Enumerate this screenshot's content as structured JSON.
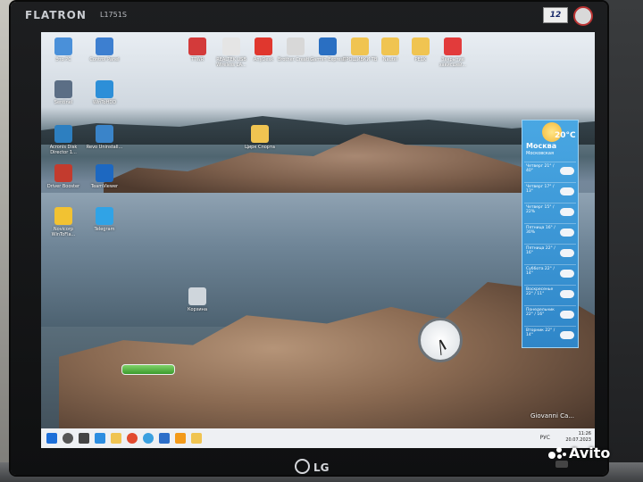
{
  "monitor": {
    "brand": "FLATRON",
    "model": "L1751S",
    "sticker_number": "12",
    "bottom_logo": "LG"
  },
  "desktop_icons": [
    {
      "label": "Это PC",
      "color": "#4a90d9"
    },
    {
      "label": "Control Panel",
      "color": "#3d7fd0"
    },
    {
      "label": "Sentinel",
      "color": "#5b6e85"
    },
    {
      "label": "WinToHDD",
      "color": "#2d8fd8"
    },
    {
      "label": "Acronis Disk Director 1...",
      "color": "#2d7fc0"
    },
    {
      "label": "Revo Uninstall...",
      "color": "#3a84c9"
    },
    {
      "label": "Driver Booster",
      "color": "#c33b2e"
    },
    {
      "label": "TeamViewer",
      "color": "#1d68c1"
    },
    {
      "label": "Novicorp WinToFla...",
      "color": "#f2c232"
    },
    {
      "label": "Telegram",
      "color": "#30a3e6"
    },
    {
      "label": "TTWR",
      "color": "#d33a3a"
    },
    {
      "label": "REALTEK USB Wireless LA...",
      "color": "#e5e5e5"
    },
    {
      "label": "AnyDesk",
      "color": "#e0372e"
    },
    {
      "label": "Brother Creati...",
      "color": "#d8d8d8"
    },
    {
      "label": "Garmin Express",
      "color": "#2a6fc2"
    },
    {
      "label": "ПРОШИВКИ ТВ",
      "color": "#f0c451"
    },
    {
      "label": "Nautel",
      "color": "#f0c451"
    },
    {
      "label": "PE1K",
      "color": "#f0c451"
    },
    {
      "label": "Закрытие зависшей...",
      "color": "#e23b3b"
    },
    {
      "label": "Корзина",
      "color": "#cfd6dc"
    },
    {
      "label": "Цирк Спорта",
      "color": "#f0c451"
    }
  ],
  "weather": {
    "temperature": "20°C",
    "city": "Москва",
    "region": "Московская",
    "forecast": [
      {
        "day": "Четверг",
        "temp": "21° / 40°"
      },
      {
        "day": "Четверг",
        "temp": "17° / 13°"
      },
      {
        "day": "Четверг",
        "temp": "15° / 22%"
      },
      {
        "day": "Пятница",
        "temp": "16° / 30%"
      },
      {
        "day": "Пятница",
        "temp": "22° / 16°"
      },
      {
        "day": "Суббота",
        "temp": "22° / 14°"
      },
      {
        "day": "Воскресенье",
        "temp": "22° / 11°"
      },
      {
        "day": "Понедельник",
        "temp": "22° / 16°"
      },
      {
        "day": "Вторник",
        "temp": "22° / 14°"
      }
    ]
  },
  "clock": {
    "hour_angle": 150,
    "minute_angle": 175
  },
  "signature": "Giovanni Ca...",
  "taskbar": {
    "language": "РУС",
    "time": "11:26",
    "date": "20.07.2023"
  },
  "watermark": "Avito"
}
